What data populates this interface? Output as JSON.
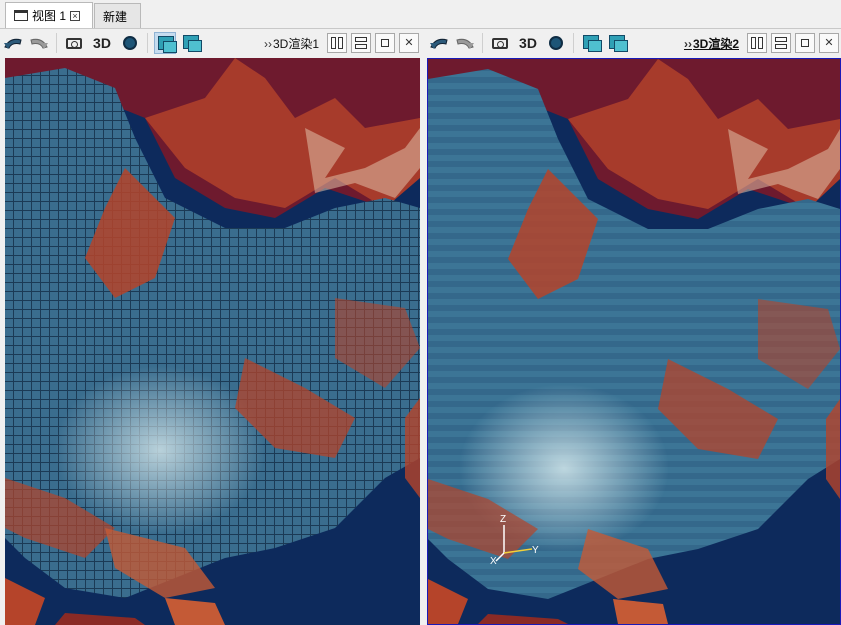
{
  "tabs": [
    {
      "label": "视图 1",
      "active": true
    },
    {
      "label": "新建",
      "active": false
    }
  ],
  "panes": [
    {
      "render_label": "3D渲染1",
      "highlighted": false,
      "toggle_3d": "3D"
    },
    {
      "render_label": "3D渲染2",
      "highlighted": true,
      "toggle_3d": "3D"
    }
  ],
  "orientation_axes": {
    "z": "Z",
    "x": "X",
    "y": "Y"
  },
  "colors": {
    "ocean": "#0d2a5c",
    "terrain_low": "#2d5b7c",
    "terrain_mid": "#9fc3cf",
    "terrain_high": "#b5442a",
    "terrain_peak": "#6e1a2e",
    "active_border": "#1a1ab8"
  }
}
